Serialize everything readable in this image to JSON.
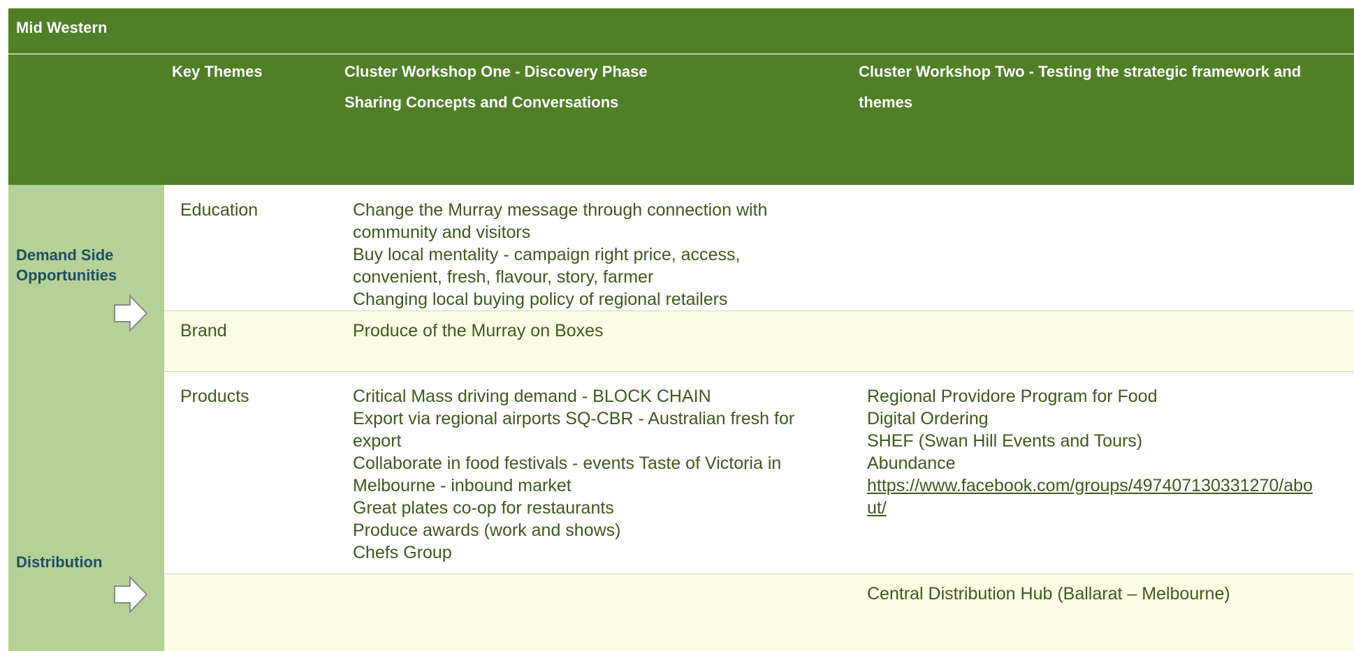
{
  "title": "Mid Western",
  "headers": {
    "key_themes": "Key Themes",
    "workshop_one": [
      "Cluster Workshop One - Discovery Phase",
      "Sharing Concepts and Conversations"
    ],
    "workshop_two": [
      "Cluster Workshop Two - Testing the strategic framework and",
      "themes"
    ]
  },
  "sections": {
    "demand": "Demand Side Opportunities",
    "distribution": "Distribution"
  },
  "rows": {
    "education": {
      "theme": "Education",
      "workshop_one": [
        "Change the Murray message through connection with",
        "community and visitors",
        "Buy local mentality - campaign right price, access,",
        "convenient, fresh, flavour, story, farmer",
        "Changing local buying policy of regional retailers"
      ]
    },
    "brand": {
      "theme": "Brand",
      "workshop_one": [
        "Produce of the Murray on Boxes"
      ]
    },
    "products": {
      "theme": "Products",
      "workshop_one": [
        "Critical Mass driving demand - BLOCK CHAIN",
        "Export via regional airports SQ-CBR - Australian fresh for",
        "export",
        "Collaborate in food festivals - events Taste of Victoria in",
        "Melbourne - inbound market",
        "Great plates co-op for restaurants",
        "Produce awards (work and shows)",
        "Chefs Group"
      ],
      "workshop_two": [
        "Regional Providore Program for Food",
        "Digital Ordering",
        "SHEF (Swan Hill Events and Tours)",
        "Abundance"
      ],
      "link_lines": [
        "https://www.facebook.com/groups/497407130331270/abo",
        "ut/"
      ]
    },
    "distribution": {
      "workshop_two": [
        "Central Distribution Hub (Ballarat – Melbourne)"
      ]
    }
  },
  "colors": {
    "header_green": "#507f28",
    "side_green": "#b5d197",
    "label_blue": "#1d4e63",
    "cell_text": "#3c5a1c",
    "cream_row": "#fdfde6"
  }
}
